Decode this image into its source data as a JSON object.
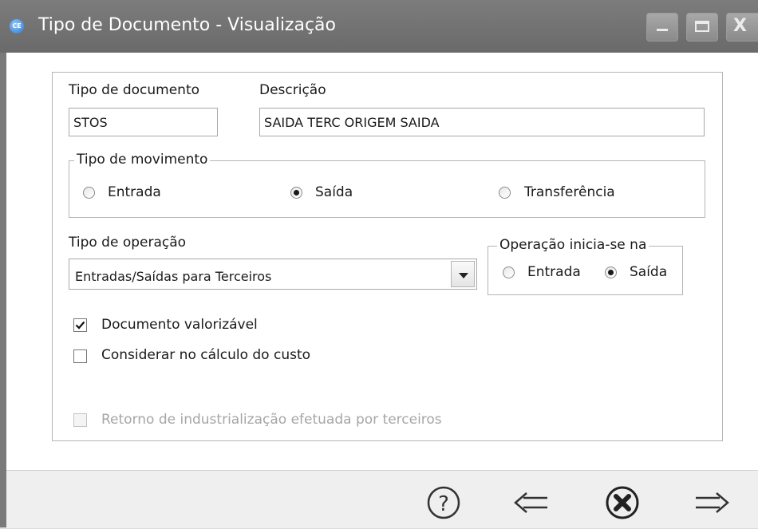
{
  "window": {
    "title": "Tipo de Documento - Visualização",
    "app_icon_text": "CE",
    "controls": [
      "minimize-icon",
      "maximize-icon",
      "close-icon"
    ]
  },
  "form": {
    "tipo_documento": {
      "label": "Tipo de documento",
      "value": "STOS"
    },
    "descricao": {
      "label": "Descrição",
      "value": "SAIDA TERC ORIGEM SAIDA"
    },
    "tipo_movimento": {
      "legend": "Tipo de movimento",
      "options": [
        {
          "label": "Entrada",
          "selected": false
        },
        {
          "label": "Saída",
          "selected": true
        },
        {
          "label": "Transferência",
          "selected": false
        }
      ]
    },
    "tipo_operacao": {
      "label": "Tipo de operação",
      "value": "Entradas/Saídas para Terceiros"
    },
    "operacao_inicia": {
      "legend": "Operação inicia-se na",
      "options": [
        {
          "label": "Entrada",
          "selected": false
        },
        {
          "label": "Saída",
          "selected": true
        }
      ]
    },
    "checkboxes": [
      {
        "label": "Documento valorizável",
        "checked": true,
        "enabled": true
      },
      {
        "label": "Considerar no cálculo do custo",
        "checked": false,
        "enabled": true
      },
      {
        "label": "Retorno de industrialização efetuada por terceiros",
        "checked": false,
        "enabled": false
      }
    ]
  },
  "footer": {
    "buttons": [
      "help-icon",
      "back-arrow-icon",
      "cancel-icon",
      "forward-arrow-icon"
    ]
  },
  "colors": {
    "titlebar": "#6f6f6f",
    "disabled_text": "#a6a6a6",
    "background": "#ffffff"
  }
}
